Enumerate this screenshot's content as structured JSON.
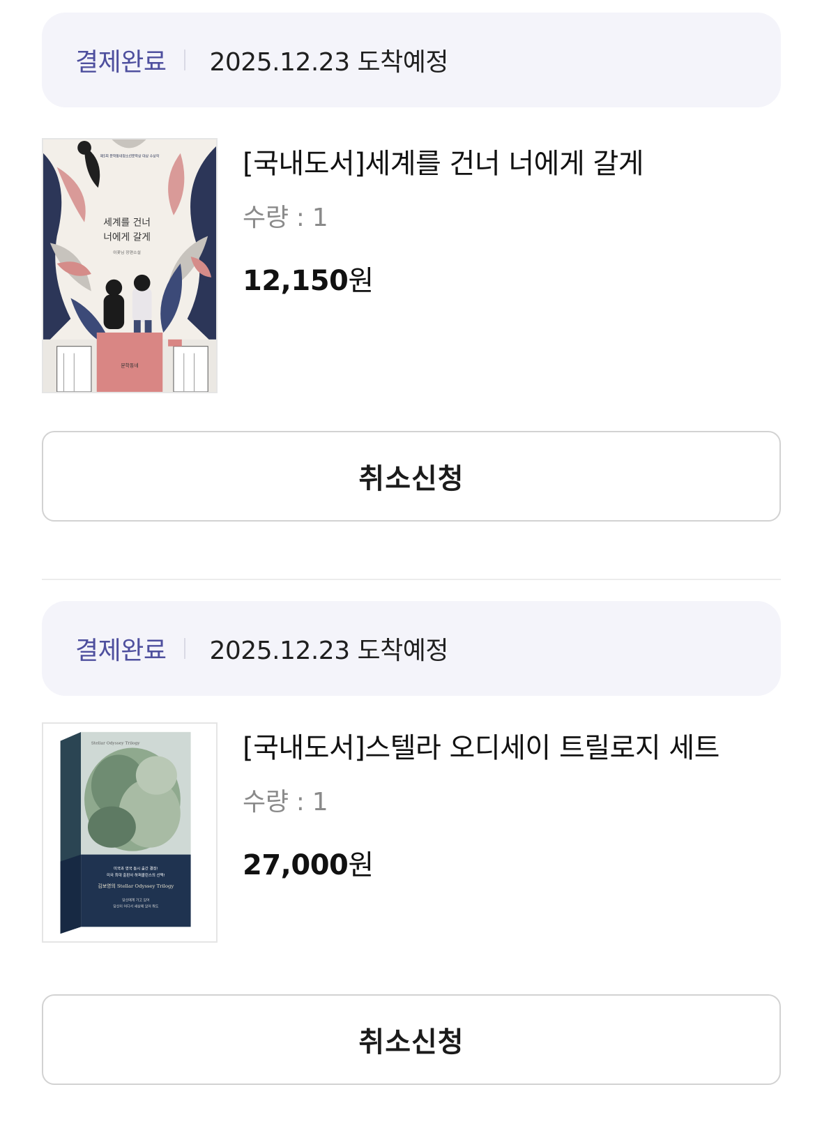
{
  "orders": [
    {
      "status": "결제완료",
      "arrival": "2025.12.23 도착예정",
      "title": "[국내도서]세계를 건너 너에게 갈게",
      "quantity": "수량 : 1",
      "price_number": "12,150",
      "price_unit": "원",
      "cancel_label": "취소신청",
      "cover": {
        "badge": "제5회 문학동네청소년문학상 대상 수상작",
        "title_line1": "세계를 건너",
        "title_line2": "너에게 갈게",
        "author": "이꽃님 장편소설",
        "publisher": "문학동네"
      }
    },
    {
      "status": "결제완료",
      "arrival": "2025.12.23 도착예정",
      "title": "[국내도서]스텔라 오디세이 트릴로지 세트",
      "quantity": "수량 : 1",
      "price_number": "27,000",
      "price_unit": "원",
      "cancel_label": "취소신청",
      "cover": {
        "english": "Stellar Odyssey Trilogy",
        "blurb1": "미국과 영국 동시 출간 결정!",
        "blurb2": "미국 최대 출판사 하퍼콜린스의 선택!",
        "series": "김보영의 Stellar Odyssey Trilogy",
        "quote1": "당신에게 가고 있어",
        "quote2": "당신이 어디서 세상에 있어 줘도"
      }
    }
  ],
  "colors": {
    "status_accent": "#4e4f9e",
    "status_bg": "#f4f4fa",
    "border": "#d2d2d2"
  }
}
